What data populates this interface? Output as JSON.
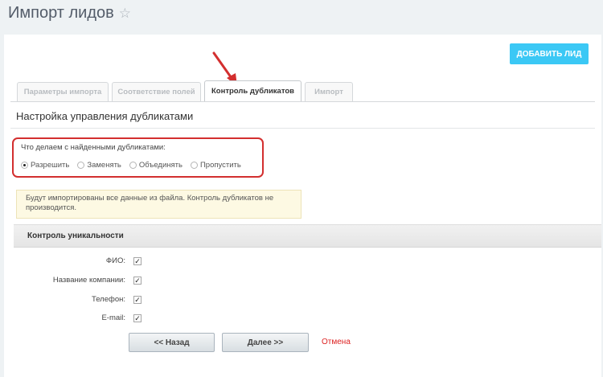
{
  "header": {
    "title": "Импорт лидов",
    "star_icon": "☆"
  },
  "toolbar": {
    "add_lead_label": "ДОБАВИТЬ ЛИД"
  },
  "tabs": [
    {
      "label": "Параметры импорта",
      "active": false
    },
    {
      "label": "Соответствие полей",
      "active": false
    },
    {
      "label": "Контроль дубликатов",
      "active": true
    },
    {
      "label": "Импорт",
      "active": false
    }
  ],
  "section": {
    "title": "Настройка управления дубликатами"
  },
  "duplicates": {
    "question": "Что делаем с найденными дубликатами:",
    "options": [
      {
        "label": "Разрешить",
        "checked": true
      },
      {
        "label": "Заменять",
        "checked": false
      },
      {
        "label": "Объединять",
        "checked": false
      },
      {
        "label": "Пропустить",
        "checked": false
      }
    ]
  },
  "notice": {
    "text": "Будут импортированы все данные из файла. Контроль дубликатов не производится."
  },
  "uniqueness": {
    "title": "Контроль уникальности",
    "fields": [
      {
        "label": "ФИО:",
        "checked": true
      },
      {
        "label": "Название компании:",
        "checked": true
      },
      {
        "label": "Телефон:",
        "checked": true
      },
      {
        "label": "E-mail:",
        "checked": true
      }
    ]
  },
  "actions": {
    "back_label": "<< Назад",
    "next_label": "Далее >>",
    "cancel_label": "Отмена"
  },
  "colors": {
    "accent": "#3bc8f5",
    "highlight_box": "#d32f2f",
    "cancel": "#dd2222"
  }
}
